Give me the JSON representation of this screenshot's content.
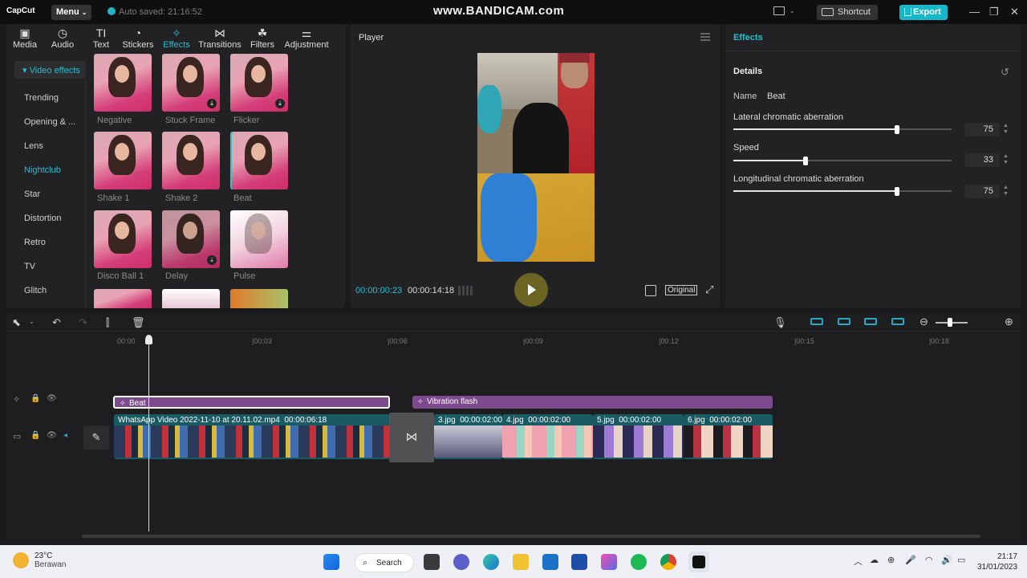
{
  "app": {
    "logo": "CapCut",
    "menu_label": "Menu",
    "autosave": "Auto saved: 21:16:52",
    "watermark": "www.BANDICAM.com",
    "shortcut_label": "Shortcut",
    "export_label": "Export"
  },
  "library": {
    "tabs": [
      {
        "label": "Media",
        "icon": "media-icon"
      },
      {
        "label": "Audio",
        "icon": "audio-icon"
      },
      {
        "label": "Text",
        "icon": "text-icon"
      },
      {
        "label": "Stickers",
        "icon": "stickers-icon"
      },
      {
        "label": "Effects",
        "icon": "effects-icon"
      },
      {
        "label": "Transitions",
        "icon": "transitions-icon"
      },
      {
        "label": "Filters",
        "icon": "filters-icon"
      },
      {
        "label": "Adjustment",
        "icon": "adjustment-icon"
      }
    ],
    "active_tab": "Effects",
    "sidebar_header": "Video effects",
    "sidebar": [
      "Trending",
      "Opening & ...",
      "Lens",
      "Nightclub",
      "Star",
      "Distortion",
      "Retro",
      "TV",
      "Glitch"
    ],
    "active_category": "Nightclub",
    "effects": [
      {
        "label": "Negative",
        "download": false
      },
      {
        "label": "Stuck Frame",
        "download": true
      },
      {
        "label": "Flicker",
        "download": true
      },
      {
        "label": "Shake 1",
        "download": false
      },
      {
        "label": "Shake 2",
        "download": false
      },
      {
        "label": "Beat",
        "download": false
      },
      {
        "label": "Disco Ball 1",
        "download": false
      },
      {
        "label": "Delay",
        "download": true
      },
      {
        "label": "Pulse",
        "download": false
      }
    ]
  },
  "player": {
    "title": "Player",
    "current_time": "00:00:00:23",
    "duration": "00:00:14:18",
    "ratio_label": "Original"
  },
  "inspector": {
    "tab": "Effects",
    "section": "Details",
    "name_label": "Name",
    "name_value": "Beat",
    "params": [
      {
        "label": "Lateral chromatic aberration",
        "value": "75",
        "fraction": 0.75
      },
      {
        "label": "Speed",
        "value": "33",
        "fraction": 0.33
      },
      {
        "label": "Longitudinal chromatic aberration",
        "value": "75",
        "fraction": 0.75
      }
    ]
  },
  "timeline": {
    "ruler": [
      "00:00",
      "|00:03",
      "|00:06",
      "|00:09",
      "|00:12",
      "|00:15",
      "|00:18"
    ],
    "effect_clips": [
      "Beat",
      "Vibration flash"
    ],
    "main_clip": {
      "name": "WhatsApp Video 2022-11-10 at 20.11.02.mp4",
      "duration": "00:00:06:18"
    },
    "image_clips": [
      {
        "name": "3.jpg",
        "duration": "00:00:02:00"
      },
      {
        "name": "4.jpg",
        "duration": "00:00:02:00"
      },
      {
        "name": "5.jpg",
        "duration": "00:00:02:00"
      },
      {
        "name": "6.jpg",
        "duration": "00:00:02:00"
      }
    ]
  },
  "taskbar": {
    "temp": "23°C",
    "weather": "Berawan",
    "search": "Search",
    "time": "21:17",
    "date": "31/01/2023"
  },
  "colors": {
    "accent": "#21c0d2",
    "effect_clip": "#7e4a8e",
    "video_clip": "#1a5b63"
  }
}
